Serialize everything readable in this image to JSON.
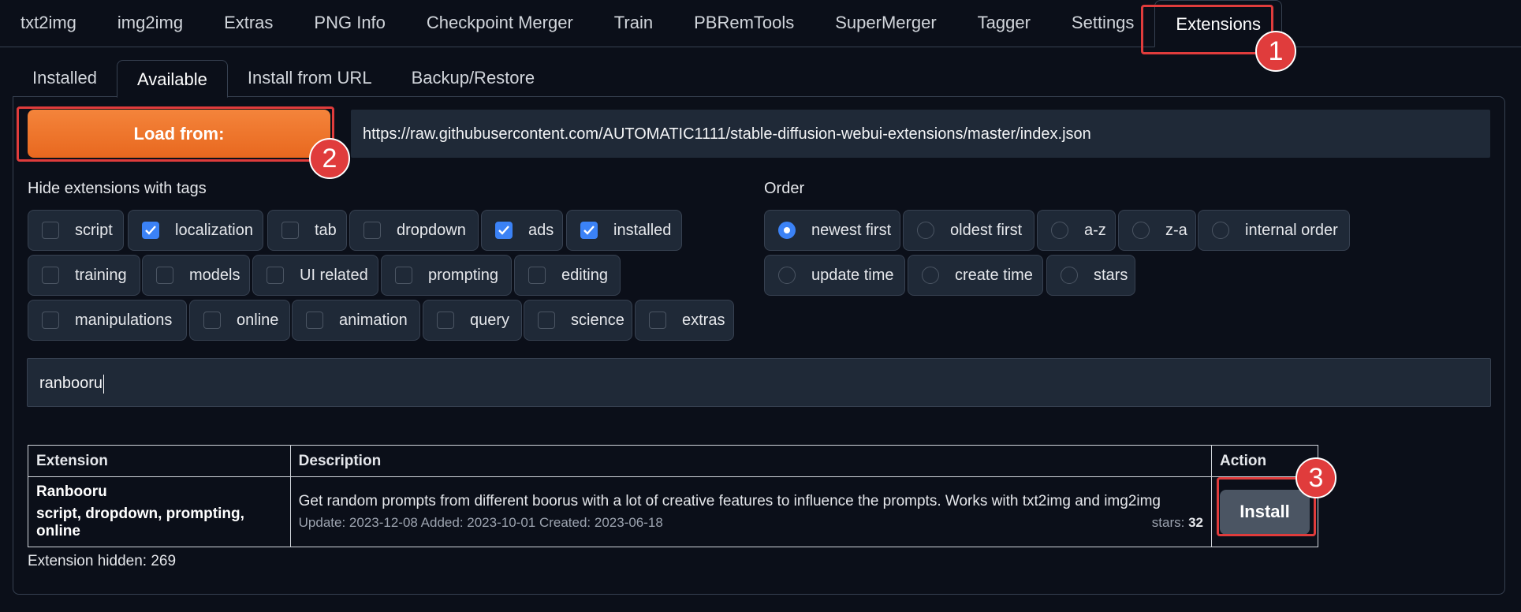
{
  "top_tabs": [
    "txt2img",
    "img2img",
    "Extras",
    "PNG Info",
    "Checkpoint Merger",
    "Train",
    "PBRemTools",
    "SuperMerger",
    "Tagger",
    "Settings",
    "Extensions"
  ],
  "sub_tabs": [
    "Installed",
    "Available",
    "Install from URL",
    "Backup/Restore"
  ],
  "load_button": "Load from:",
  "url": "https://raw.githubusercontent.com/AUTOMATIC1111/stable-diffusion-webui-extensions/master/index.json",
  "hide_tags_label": "Hide extensions with tags",
  "tags": [
    {
      "label": "script",
      "checked": false
    },
    {
      "label": "localization",
      "checked": true
    },
    {
      "label": "tab",
      "checked": false
    },
    {
      "label": "dropdown",
      "checked": false
    },
    {
      "label": "ads",
      "checked": true
    },
    {
      "label": "installed",
      "checked": true
    },
    {
      "label": "training",
      "checked": false
    },
    {
      "label": "models",
      "checked": false
    },
    {
      "label": "UI related",
      "checked": false
    },
    {
      "label": "prompting",
      "checked": false
    },
    {
      "label": "editing",
      "checked": false
    },
    {
      "label": "manipulations",
      "checked": false
    },
    {
      "label": "online",
      "checked": false
    },
    {
      "label": "animation",
      "checked": false
    },
    {
      "label": "query",
      "checked": false
    },
    {
      "label": "science",
      "checked": false
    },
    {
      "label": "extras",
      "checked": false
    }
  ],
  "order_label": "Order",
  "order_options": [
    {
      "label": "newest first",
      "checked": true
    },
    {
      "label": "oldest first",
      "checked": false
    },
    {
      "label": "a-z",
      "checked": false
    },
    {
      "label": "z-a",
      "checked": false
    },
    {
      "label": "internal order",
      "checked": false
    },
    {
      "label": "update time",
      "checked": false
    },
    {
      "label": "create time",
      "checked": false
    },
    {
      "label": "stars",
      "checked": false
    }
  ],
  "search_value": "ranbooru",
  "table": {
    "headers": [
      "Extension",
      "Description",
      "Action"
    ],
    "rows": [
      {
        "name": "Ranbooru",
        "tags": "script, dropdown, prompting, online",
        "description": "Get random prompts from different boorus with a lot of creative features to influence the prompts. Works with txt2img and img2img",
        "dates": "Update: 2023-12-08 Added: 2023-10-01 Created: 2023-06-18",
        "stars_label": "stars:",
        "stars": "32",
        "action": "Install"
      }
    ]
  },
  "hidden_count": "Extension hidden: 269",
  "annotations": [
    "1",
    "2",
    "3"
  ],
  "colors": {
    "accent": "#e8681f",
    "checked": "#3b82f6",
    "annotation": "#e03c3c"
  }
}
